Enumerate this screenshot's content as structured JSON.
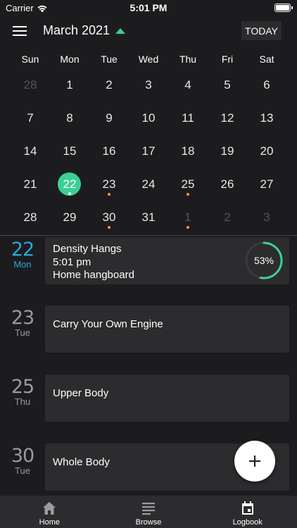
{
  "status_bar": {
    "carrier": "Carrier",
    "time": "5:01 PM"
  },
  "header": {
    "month": "March 2021",
    "today_label": "TODAY",
    "accent": "#3ecf95"
  },
  "weekdays": [
    "Sun",
    "Mon",
    "Tue",
    "Wed",
    "Thu",
    "Fri",
    "Sat"
  ],
  "calendar": {
    "weeks": [
      [
        {
          "d": "28",
          "muted": true
        },
        {
          "d": "1"
        },
        {
          "d": "2"
        },
        {
          "d": "3"
        },
        {
          "d": "4"
        },
        {
          "d": "5"
        },
        {
          "d": "6"
        }
      ],
      [
        {
          "d": "7"
        },
        {
          "d": "8"
        },
        {
          "d": "9"
        },
        {
          "d": "10"
        },
        {
          "d": "11"
        },
        {
          "d": "12"
        },
        {
          "d": "13"
        }
      ],
      [
        {
          "d": "14"
        },
        {
          "d": "15"
        },
        {
          "d": "16"
        },
        {
          "d": "17"
        },
        {
          "d": "18"
        },
        {
          "d": "19"
        },
        {
          "d": "20"
        }
      ],
      [
        {
          "d": "21"
        },
        {
          "d": "22",
          "selected": true,
          "dot": "white"
        },
        {
          "d": "23",
          "dot": "orange"
        },
        {
          "d": "24"
        },
        {
          "d": "25",
          "dot": "orange"
        },
        {
          "d": "26"
        },
        {
          "d": "27"
        }
      ],
      [
        {
          "d": "28"
        },
        {
          "d": "29"
        },
        {
          "d": "30",
          "dot": "orange"
        },
        {
          "d": "31"
        },
        {
          "d": "1",
          "muted": true,
          "dot": "orange"
        },
        {
          "d": "2",
          "muted": true
        },
        {
          "d": "3",
          "muted": true
        }
      ]
    ]
  },
  "log": [
    {
      "day_num": "22",
      "day_name": "Mon",
      "today": true,
      "lines": [
        "Density Hangs",
        "5:01 pm",
        "Home hangboard"
      ],
      "progress": 53,
      "progress_label": "53%"
    },
    {
      "day_num": "23",
      "day_name": "Tue",
      "lines": [
        "Carry Your Own Engine"
      ]
    },
    {
      "day_num": "25",
      "day_name": "Thu",
      "lines": [
        "Upper Body"
      ]
    },
    {
      "day_num": "30",
      "day_name": "Tue",
      "lines": [
        "Whole Body"
      ]
    }
  ],
  "fab": {
    "icon": "plus-icon"
  },
  "tabs": [
    {
      "label": "Home",
      "icon": "home-icon"
    },
    {
      "label": "Browse",
      "icon": "list-icon"
    },
    {
      "label": "Logbook",
      "icon": "calendar-icon"
    }
  ]
}
